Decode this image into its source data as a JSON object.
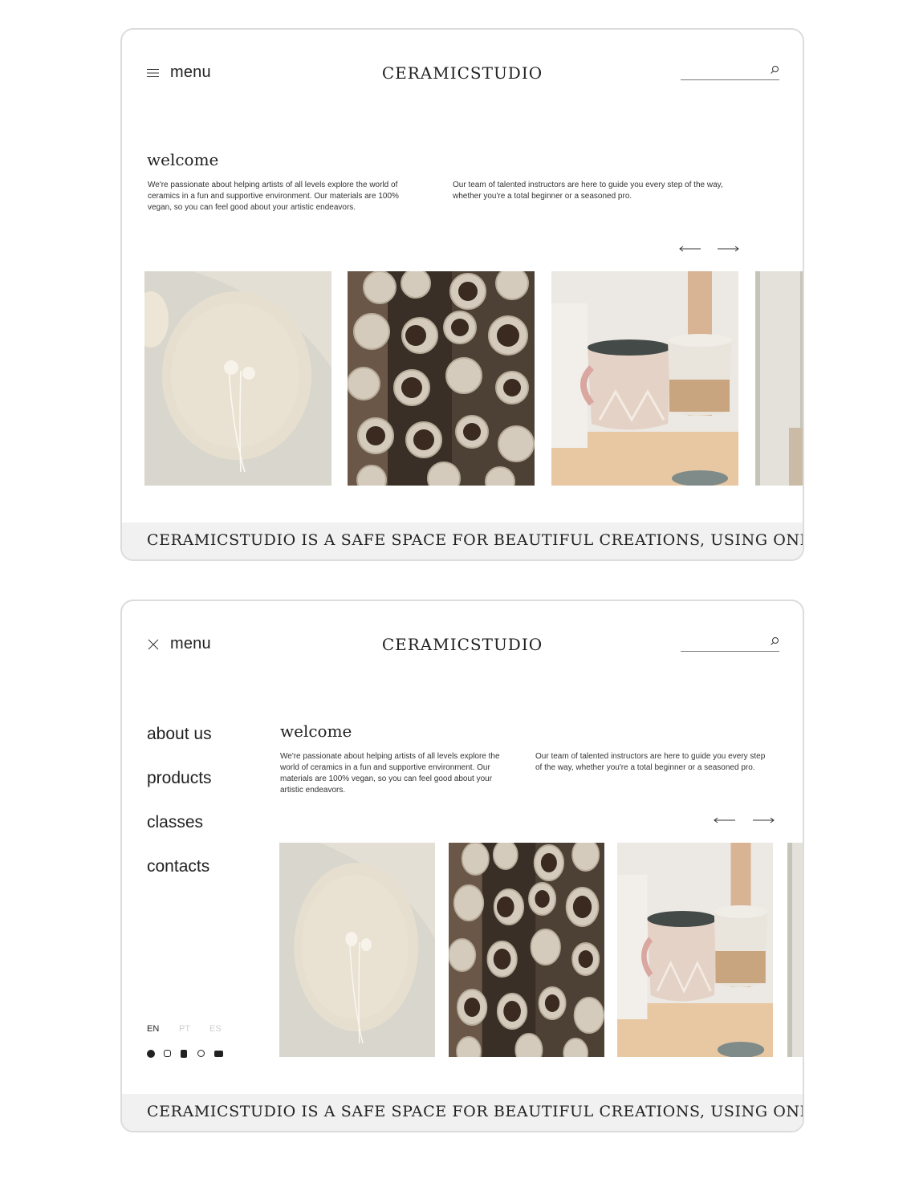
{
  "header": {
    "menu_label": "menu",
    "logo": "CERAMICSTUDIO",
    "search_placeholder": ""
  },
  "welcome": {
    "title": "welcome",
    "paragraph_1": "We're passionate about helping artists of all levels explore the world of ceramics in a fun and supportive environment. Our materials are 100% vegan, so you can feel good about your artistic endeavors.",
    "paragraph_2": "Our team of talented instructors are here to guide you every step of the way, whether you're a total beginner or a seasoned pro."
  },
  "gallery": {
    "images": [
      "plate-with-dried-flower",
      "ceramic-pots-top-view",
      "mugs-on-shelf",
      "vase-partial"
    ]
  },
  "marquee": {
    "text": "CERAMICSTUDIO IS A SAFE SPACE FOR BEAUTIFUL CREATIONS, USING ONLY VEGAN MATERIALS"
  },
  "nav": {
    "items": [
      "about us",
      "products",
      "classes",
      "contacts"
    ]
  },
  "languages": {
    "items": [
      "EN",
      "PT",
      "ES"
    ],
    "active": "EN"
  },
  "social": {
    "icons": [
      "facebook-icon",
      "instagram-icon",
      "tiktok-icon",
      "whatsapp-icon",
      "youtube-icon"
    ]
  },
  "colors": {
    "text": "#222222",
    "border": "#dcdcdc",
    "marquee_bg": "#f1f1f1",
    "inactive_lang": "#cfcfcf"
  }
}
